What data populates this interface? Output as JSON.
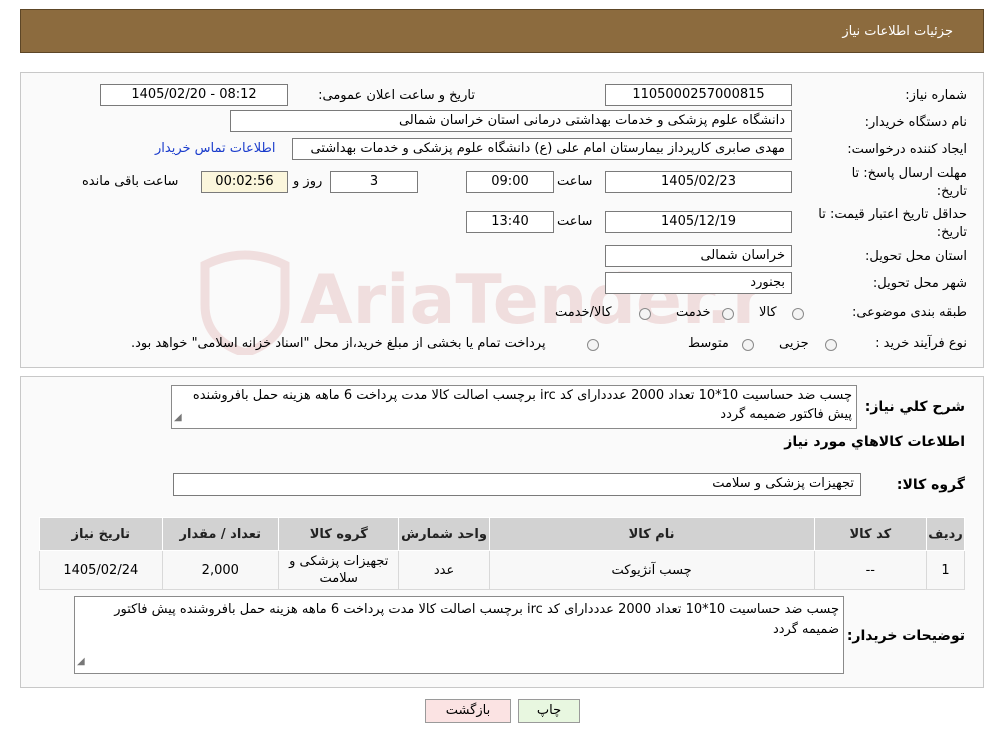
{
  "page": {
    "header_title": "جزئیات اطلاعات نیاز"
  },
  "form": {
    "need_number_label": "شماره نیاز:",
    "need_number": "1105000257000815",
    "announce_label": "تاریخ و ساعت اعلان عمومی:",
    "announce_value": "1405/02/20 - 08:12",
    "buyer_label": "نام دستگاه خریدار:",
    "buyer_value": "دانشگاه علوم پزشکی و خدمات بهداشتی درمانی استان خراسان شمالی",
    "creator_label": "ایجاد کننده درخواست:",
    "creator_value": "مهدی صابری کارپرداز بیمارستان امام علی (ع) دانشگاه علوم پزشکی و خدمات بهداشتی",
    "contact_link": "اطلاعات تماس خریدار",
    "deadline_label_1": "مهلت ارسال پاسخ: تا",
    "deadline_label_2": "تاریخ:",
    "deadline_date": "1405/02/23",
    "time_label": "ساعت",
    "deadline_time": "09:00",
    "days_value": "3",
    "days_label": "روز و",
    "remaining_value": "00:02:56",
    "remaining_label": "ساعت باقی مانده",
    "validity_label_1": "حداقل تاریخ اعتبار قیمت: تا",
    "validity_label_2": "تاریخ:",
    "validity_date": "1405/12/19",
    "validity_time": "13:40",
    "province_label": "استان محل تحویل:",
    "province_value": "خراسان شمالی",
    "city_label": "شهر محل تحویل:",
    "city_value": "بجنورد",
    "category_label": "طبقه بندی موضوعی:",
    "category_options": [
      "کالا",
      "خدمت",
      "کالا/خدمت"
    ],
    "process_label": "نوع فرآیند خرید :",
    "process_options": [
      "جزیی",
      "متوسط"
    ],
    "process_note": "پرداخت تمام یا بخشی از مبلغ خرید،از محل \"اسناد خزانه اسلامی\" خواهد بود."
  },
  "details": {
    "summary_label": "شرح کلي نياز:",
    "summary_text": "چسب ضد حساسیت 10*10 تعداد 2000 عدددارای کد irc برچسب اصالت کالا مدت پرداخت 6 ماهه هزینه حمل بافروشنده پیش فاکتور ضمیمه گردد",
    "items_title": "اطلاعات کالاهاي مورد نياز",
    "group_label": "گروه کالا:",
    "group_value": "تجهیزات پزشکی و سلامت",
    "table_headers": [
      "ردیف",
      "کد کالا",
      "نام کالا",
      "واحد شمارش",
      "گروه کالا",
      "تعداد / مقدار",
      "تاریخ نیاز"
    ],
    "rows": [
      {
        "row": "1",
        "code": "--",
        "name": "چسب آنژیوکت",
        "unit": "عدد",
        "group": "تجهیزات پزشکی و سلامت",
        "qty": "2,000",
        "date": "1405/02/24"
      }
    ],
    "buyer_notes_label": "توضیحات خریدار:",
    "buyer_notes": "چسب ضد حساسیت 10*10 تعداد 2000 عدددارای کد irc برچسب اصالت کالا مدت پرداخت 6 ماهه هزینه حمل بافروشنده پیش فاکتور ضمیمه گردد"
  },
  "buttons": {
    "print": "چاپ",
    "back": "بازگشت"
  },
  "watermark": {
    "text": "AriaTender.neT"
  },
  "colors": {
    "header_bg": "#8c6b3e",
    "link": "#1a3ccc",
    "back_button_bg": "#fbe3e3",
    "print_button_bg": "#e8f7e0"
  }
}
